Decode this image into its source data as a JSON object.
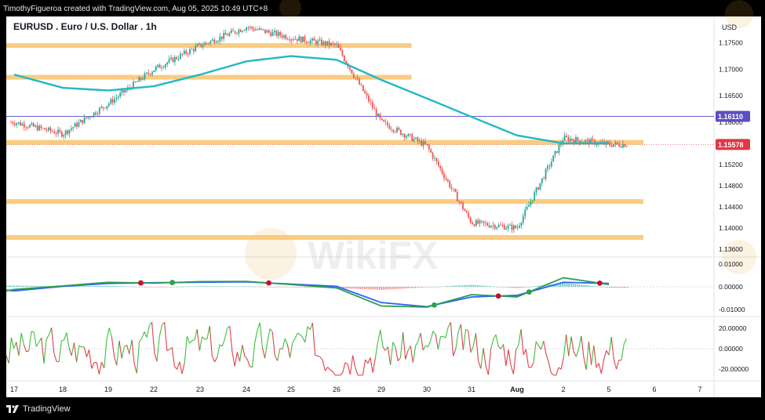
{
  "header": {
    "attribution": "TimothyFigueroa created with TradingView.com, Aug 05, 2025 10:49 UTC+8"
  },
  "footer": {
    "brand": "TradingView"
  },
  "chart_data": {
    "type": "line",
    "symbol_title": "EURUSD . Euro / U.S. Dollar . 1h",
    "currency": "USD",
    "x_ticks": [
      "17",
      "18",
      "19",
      "22",
      "23",
      "24",
      "25",
      "26",
      "29",
      "30",
      "31",
      "Aug",
      "2",
      "5",
      "6",
      "7"
    ],
    "price_axis": {
      "ticks": [
        "1.17500",
        "1.17000",
        "1.16500",
        "1.16000",
        "1.15200",
        "1.14800",
        "1.14400",
        "1.14000",
        "1.13600"
      ],
      "ylim": [
        1.1345,
        1.18
      ],
      "badges": [
        {
          "label": "1.16110",
          "value": 1.1611,
          "color": "#5b4fc4"
        },
        {
          "label": "1.15578",
          "value": 1.15578,
          "color": "#e23645"
        }
      ]
    },
    "horizontal_levels": [
      {
        "name": "resistance-zone",
        "value": 1.1745,
        "x_end_day": "26.8"
      },
      {
        "name": "upper-mid-zone",
        "value": 1.1685,
        "x_end_day": "26.8"
      },
      {
        "name": "pivot-line",
        "value": 1.1611
      },
      {
        "name": "current-zone",
        "value": 1.1562
      },
      {
        "name": "support-zone-1",
        "value": 1.145
      },
      {
        "name": "support-zone-2",
        "value": 1.1382
      }
    ],
    "price_series": {
      "name": "EURUSD 1h",
      "dates": [
        "17",
        "18",
        "19",
        "22",
        "23",
        "24",
        "25",
        "26",
        "29",
        "30",
        "31",
        "Aug",
        "2",
        "5"
      ],
      "close": [
        1.16,
        1.1578,
        1.1635,
        1.17,
        1.1745,
        1.178,
        1.176,
        1.1745,
        1.16,
        1.1555,
        1.141,
        1.14,
        1.157,
        1.1558
      ],
      "ma_close": [
        1.169,
        1.1665,
        1.166,
        1.1668,
        1.169,
        1.1715,
        1.1725,
        1.1718,
        1.168,
        1.1645,
        1.161,
        1.1575,
        1.156,
        1.156
      ]
    },
    "macd": {
      "ticks": [
        "0.01000",
        "0.00000",
        "-0.01000"
      ],
      "ylim": [
        -0.0125,
        0.0125
      ],
      "macd": [
        -0.0012,
        0.0004,
        0.002,
        0.0016,
        0.0023,
        0.0024,
        0.001,
        -0.0005,
        -0.0085,
        -0.009,
        -0.0035,
        -0.0045,
        0.004,
        0.001
      ],
      "signal": [
        -0.0018,
        0.0002,
        0.0015,
        0.0018,
        0.002,
        0.0022,
        0.0012,
        0.0002,
        -0.007,
        -0.0088,
        -0.0045,
        -0.0038,
        0.002,
        0.0015
      ]
    },
    "oscillator": {
      "ticks": [
        "20.00000",
        "0.00000",
        "-20.00000"
      ],
      "ylim": [
        -30,
        30
      ]
    }
  }
}
